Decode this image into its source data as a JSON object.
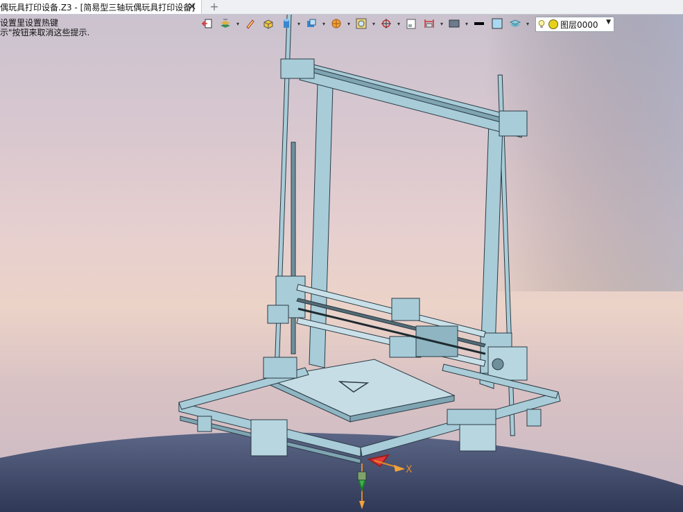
{
  "window": {
    "tab_title": "偶玩具打印设备.Z3 - [简易型三轴玩偶玩具打印设备]",
    "close_icon": "close-icon",
    "add_icon": "plus-icon",
    "add_label": "+"
  },
  "hint": {
    "line1": "设置里设置热键",
    "line2": "示\"按钮来取消这些提示."
  },
  "toolbar": {
    "icons": [
      "exit-icon",
      "layers-icon",
      "pen-icon",
      "box-icon",
      "cylinder-icon",
      "shaded-box-icon",
      "sphere-icon",
      "frame-icon",
      "target-icon",
      "sheet-icon",
      "dimension-icon",
      "screen-icon",
      "line-color-icon",
      "fill-color-icon",
      "stack-icon"
    ]
  },
  "layer": {
    "label": "图层0000",
    "bulb_icon": "bulb-icon",
    "status_color": "#e6d21c"
  },
  "gizmo": {
    "x_label": "X"
  },
  "colors": {
    "model": "#9fc3d0",
    "model_dark": "#5f7f8c",
    "floor": "#3f4a6a"
  }
}
